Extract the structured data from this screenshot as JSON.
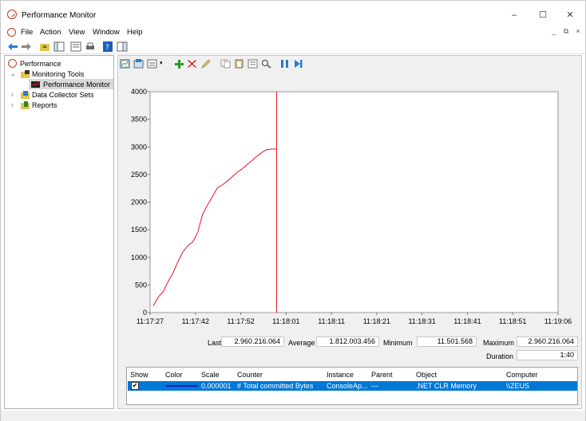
{
  "window": {
    "title": "Performance Monitor",
    "minimize": "–",
    "maximize": "☐",
    "close": "✕"
  },
  "menu": {
    "items": [
      {
        "label": "File"
      },
      {
        "label": "Action"
      },
      {
        "label": "View"
      },
      {
        "label": "Window"
      },
      {
        "label": "Help"
      }
    ],
    "mdi_controls": [
      "_",
      "⧉",
      "×"
    ]
  },
  "tree": {
    "root": "Performance",
    "monitoring_tools": "Monitoring Tools",
    "performance_monitor": "Performance Monitor",
    "data_collector_sets": "Data Collector Sets",
    "reports": "Reports"
  },
  "chart_data": {
    "type": "line",
    "ylim": [
      0,
      4000
    ],
    "yticks": [
      "4000",
      "3500",
      "3000",
      "2500",
      "2000",
      "1500",
      "1000",
      "500",
      "0"
    ],
    "xticks": [
      "11:17:27",
      "11:17:42",
      "11:17:52",
      "11:18:01",
      "11:18:11",
      "11:18:21",
      "11:18:31",
      "11:18:41",
      "11:18:51",
      "11:19:06"
    ],
    "series": [
      {
        "color": "#e81123",
        "values": [
          120,
          280,
          380,
          560,
          720,
          920,
          1100,
          1210,
          1280,
          1450,
          1780,
          1950,
          2100,
          2260,
          2310,
          2380,
          2460,
          2540,
          2600,
          2680,
          2750,
          2830,
          2900,
          2950,
          2960,
          2960
        ]
      }
    ],
    "series_end_fraction": 0.31,
    "grid": false
  },
  "stats": {
    "last_label": "Last",
    "last_value": "2.960.216.064",
    "average_label": "Average",
    "average_value": "1.812.003.456",
    "minimum_label": "Minimum",
    "minimum_value": "11.501.568",
    "maximum_label": "Maximum",
    "maximum_value": "2.960.216.064",
    "duration_label": "Duration",
    "duration_value": "1:40"
  },
  "counters": {
    "headers": [
      "Show",
      "Color",
      "Scale",
      "Counter",
      "Instance",
      "Parent",
      "Object",
      "Computer"
    ],
    "rows": [
      {
        "show": "✔",
        "scale": "0,000001",
        "counter": "# Total committed Bytes",
        "instance": "ConsoleAp...",
        "parent": "---",
        "object": ".NET CLR Memory",
        "computer": "\\\\ZEUS"
      }
    ]
  }
}
